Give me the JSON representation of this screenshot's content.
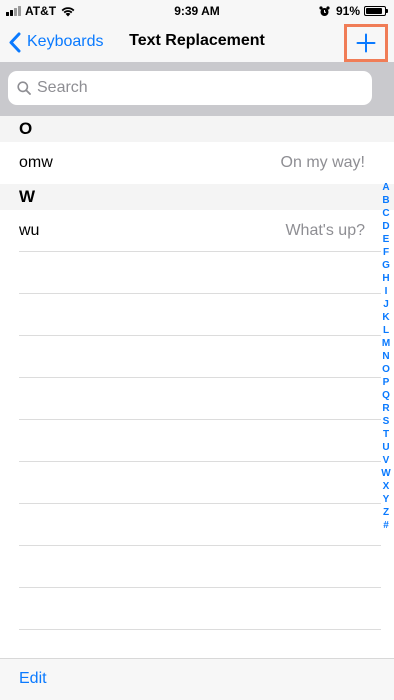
{
  "status_bar": {
    "carrier": "AT&T",
    "time": "9:39 AM",
    "battery_percent": "91%",
    "battery_level": 0.91
  },
  "nav": {
    "back_label": "Keyboards",
    "title": "Text Replacement",
    "add_icon": "plus-icon"
  },
  "search": {
    "placeholder": "Search"
  },
  "sections": [
    {
      "header": "O",
      "rows": [
        {
          "shortcut": "omw",
          "phrase": "On my way!"
        }
      ]
    },
    {
      "header": "W",
      "rows": [
        {
          "shortcut": "wu",
          "phrase": "What's up?"
        }
      ]
    }
  ],
  "index_letters": [
    "A",
    "B",
    "C",
    "D",
    "E",
    "F",
    "G",
    "H",
    "I",
    "J",
    "K",
    "L",
    "M",
    "N",
    "O",
    "P",
    "Q",
    "R",
    "S",
    "T",
    "U",
    "V",
    "W",
    "X",
    "Y",
    "Z",
    "#"
  ],
  "toolbar": {
    "edit_label": "Edit"
  },
  "colors": {
    "accent": "#0a7aff",
    "highlight": "#f07d57",
    "secondary_text": "#8e8e93"
  }
}
